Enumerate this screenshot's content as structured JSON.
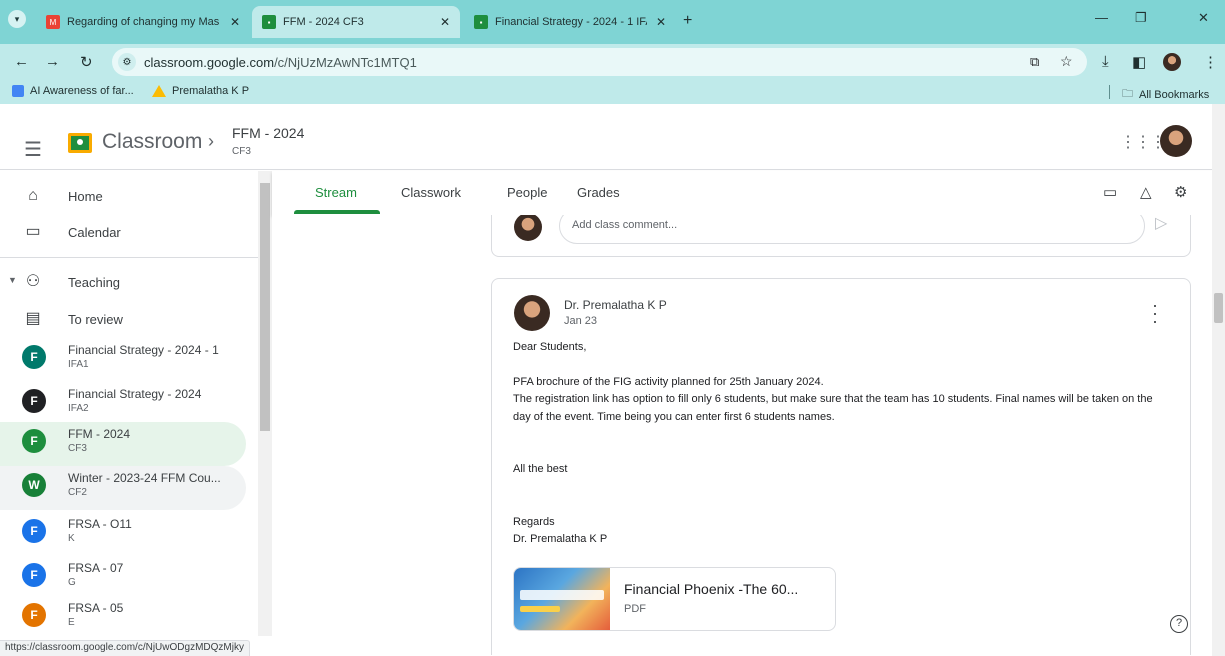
{
  "browser": {
    "tabs": [
      {
        "title": "Regarding of changing my Mas",
        "icon": "gmail-icon",
        "active": false
      },
      {
        "title": "FFM - 2024 CF3",
        "icon": "classroom-icon",
        "active": true
      },
      {
        "title": "Financial Strategy - 2024 - 1 IFA",
        "icon": "classroom-icon",
        "active": false
      }
    ],
    "url_host": "classroom.google.com",
    "url_path": "/c/NjUzMzAwNTc1MTQ1",
    "bookmarks": [
      {
        "label": "AI Awareness of far...",
        "icon": "forms-icon"
      },
      {
        "label": "Premalatha K P",
        "icon": "drive-icon"
      }
    ],
    "all_bookmarks": "All Bookmarks",
    "status_url": "https://classroom.google.com/c/NjUwODgzMDQzMjky"
  },
  "header": {
    "app_name": "Classroom",
    "class_name": "FFM - 2024",
    "class_section": "CF3"
  },
  "sidebar": {
    "home": "Home",
    "calendar": "Calendar",
    "teaching": "Teaching",
    "to_review": "To review",
    "classes": [
      {
        "name": "Financial Strategy - 2024 - 1",
        "section": "IFA1",
        "letter": "F",
        "color": "#00796b"
      },
      {
        "name": "Financial Strategy - 2024",
        "section": "IFA2",
        "letter": "F",
        "color": "#202124"
      },
      {
        "name": "FFM - 2024",
        "section": "CF3",
        "letter": "F",
        "color": "#1e8e3e"
      },
      {
        "name": "Winter - 2023-24 FFM Cou...",
        "section": "CF2",
        "letter": "W",
        "color": "#188038"
      },
      {
        "name": "FRSA - O11",
        "section": "K",
        "letter": "F",
        "color": "#1a73e8"
      },
      {
        "name": "FRSA - 07",
        "section": "G",
        "letter": "F",
        "color": "#1a73e8"
      },
      {
        "name": "FRSA - 05",
        "section": "E",
        "letter": "F",
        "color": "#e37400"
      }
    ]
  },
  "class_tabs": {
    "stream": "Stream",
    "classwork": "Classwork",
    "people": "People",
    "grades": "Grades"
  },
  "comment": {
    "placeholder": "Add class comment..."
  },
  "post": {
    "author": "Dr. Premalatha K P",
    "date": "Jan 23",
    "greeting": "Dear Students,",
    "line1": "PFA brochure of the FIG activity planned for 25th January 2024.",
    "line2": "The registration link has option to fill only 6 students, but make sure that the team has 10 students. Final names will be taken on the  day of the event. Time being you can enter first 6 students names.",
    "wish": "All the best",
    "regards": "Regards",
    "signature": "Dr. Premalatha K P",
    "attachment_title": "Financial Phoenix -The 60...",
    "attachment_type": "PDF"
  },
  "colors": {
    "browser_frame": "#7fd4d4",
    "accent_green": "#1e8e3e"
  }
}
